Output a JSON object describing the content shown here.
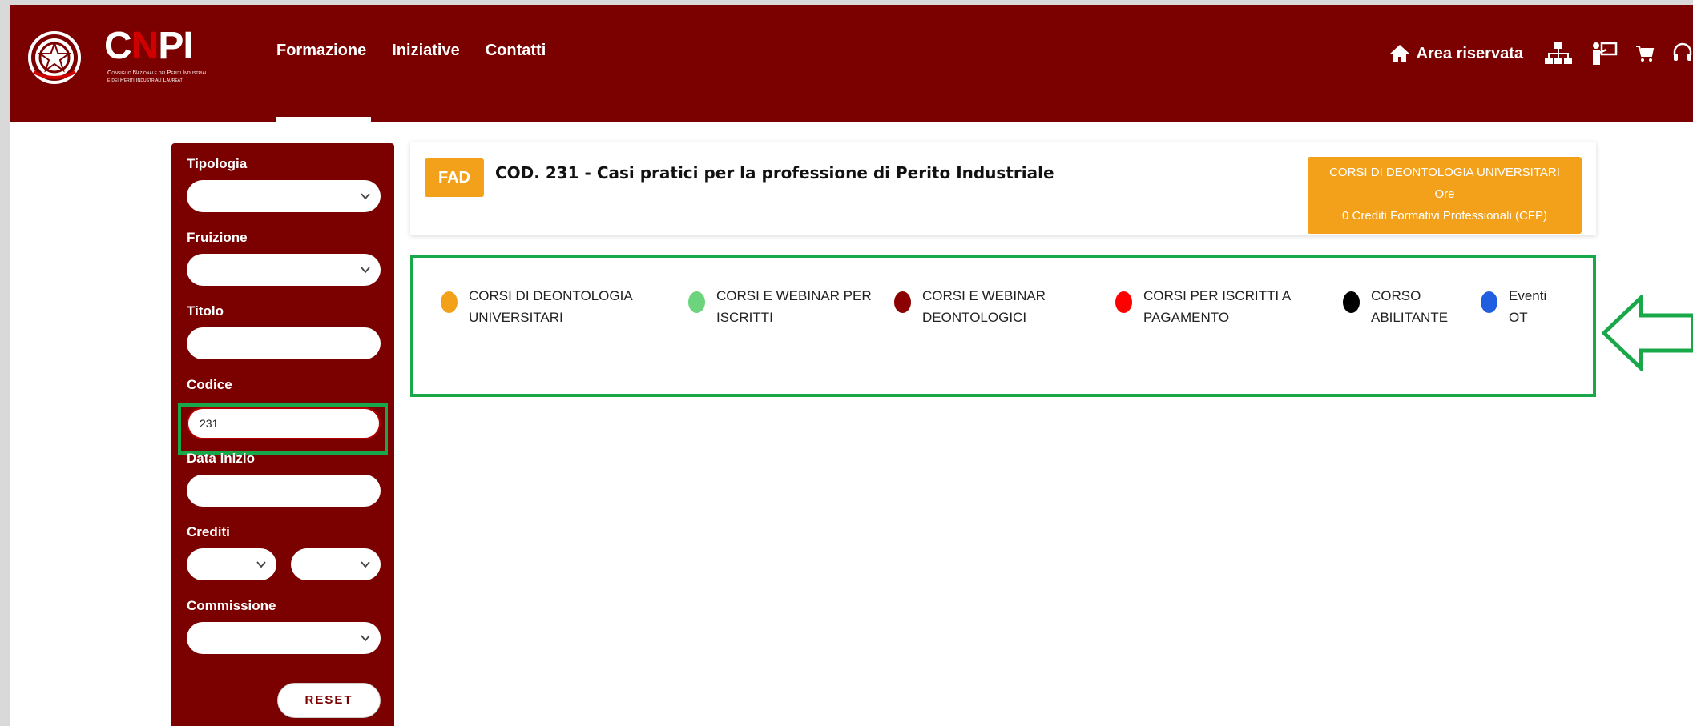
{
  "brand": {
    "logo_text_c": "C",
    "logo_text_n": "N",
    "logo_text_pi": "PI",
    "subtitle_line1": "Consiglio Nazionale dei Periti Industriali",
    "subtitle_line2": "e dei Periti Industriali Laureati"
  },
  "nav": {
    "items": [
      {
        "label": "Formazione",
        "active": true
      },
      {
        "label": "Iniziative"
      },
      {
        "label": "Contatti"
      }
    ]
  },
  "right_nav": {
    "area_riservata": "Area riservata",
    "icons": [
      "home-icon",
      "org-chart-icon",
      "teacher-icon",
      "cart-icon",
      "headset-icon"
    ]
  },
  "filters": {
    "tipologia": {
      "label": "Tipologia",
      "value": ""
    },
    "fruizione": {
      "label": "Fruizione",
      "value": ""
    },
    "titolo": {
      "label": "Titolo",
      "value": ""
    },
    "codice": {
      "label": "Codice",
      "value": "231"
    },
    "data_inizio": {
      "label": "Data inizio",
      "value": ""
    },
    "crediti": {
      "label": "Crediti",
      "min": "",
      "max": ""
    },
    "commissione": {
      "label": "Commissione",
      "value": ""
    },
    "reset_label": "RESET"
  },
  "course": {
    "type_badge": "FAD",
    "title": "COD. 231 - Casi pratici per la professione di Perito Industriale",
    "category": "CORSI DI DEONTOLOGIA UNIVERSITARI",
    "hours": "Ore",
    "credits": "0 Crediti Formativi Professionali (CFP)"
  },
  "legend": [
    {
      "line1": "CORSI DI DEONTOLOGIA",
      "line2": "UNIVERSITARI",
      "color": "#f3a11a"
    },
    {
      "line1": "CORSI E WEBINAR PER",
      "line2": "ISCRITTI",
      "color": "#6dd47e"
    },
    {
      "line1": "CORSI E WEBINAR",
      "line2": "DEONTOLOGICI",
      "color": "#8b0000"
    },
    {
      "line1": "CORSI PER ISCRITTI A",
      "line2": "PAGAMENTO",
      "color": "#ff0000"
    },
    {
      "line1": "CORSO",
      "line2": "ABILITANTE",
      "color": "#000000"
    },
    {
      "line1": "Eventi",
      "line2": "OT",
      "color": "#1f5fe0"
    }
  ],
  "colors": {
    "brand": "#7b0000",
    "accent": "#f3a11a",
    "highlight": "#18a84a"
  }
}
